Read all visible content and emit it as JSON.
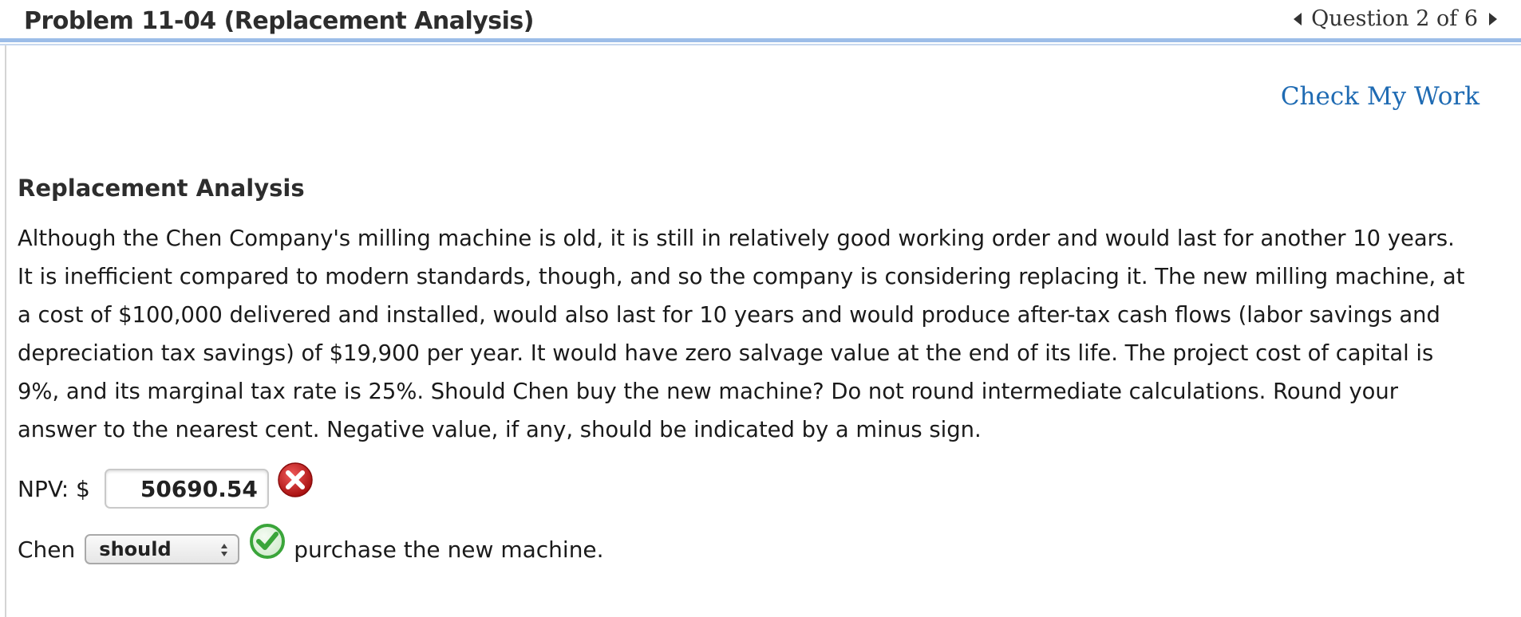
{
  "header": {
    "title": "Problem 11-04 (Replacement Analysis)",
    "question_nav": "Question 2 of 6",
    "prev_icon": "triangle-left-icon",
    "next_icon": "triangle-right-icon"
  },
  "check_my_work": "Check My Work",
  "section_title": "Replacement Analysis",
  "problem_lines": [
    "Although the Chen Company's milling machine is old, it is still in relatively good working order and would last for another 10 years.",
    "It is inefficient compared to modern standards, though, and so the company is considering replacing it. The new milling machine, at",
    "a cost of $100,000 delivered and installed, would also last for 10 years and would produce after-tax cash flows (labor savings and",
    "depreciation tax savings) of $19,900 per year. It would have zero salvage value at the end of its life. The project cost of capital is",
    "9%, and its marginal tax rate is 25%. Should Chen buy the new machine? Do not round intermediate calculations. Round your",
    "answer to the nearest cent. Negative value, if any, should be indicated by a minus sign."
  ],
  "npv": {
    "label": "NPV: $",
    "value": "50690.54",
    "status_icon": "incorrect-x-icon"
  },
  "decision": {
    "prefix": "Chen",
    "selected": "should",
    "status_icon": "correct-check-icon",
    "suffix": "purchase the new machine."
  },
  "colors": {
    "header_rule": "#9cbde8",
    "link": "#1f6bb3",
    "incorrect": "#c41e1e",
    "correct": "#3aa53a"
  }
}
